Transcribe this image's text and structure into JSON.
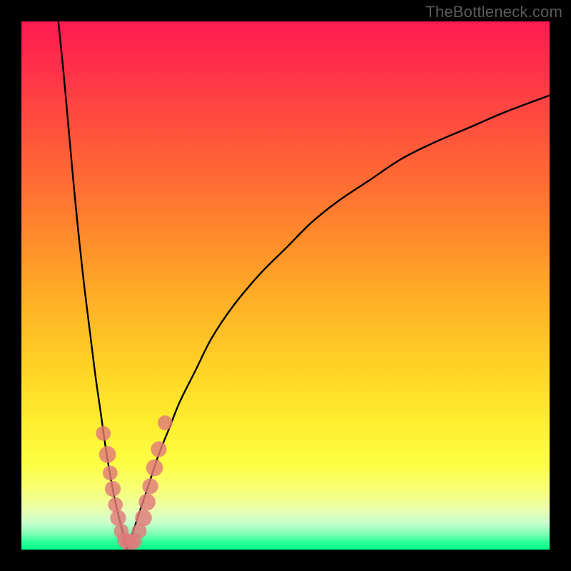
{
  "watermark": "TheBottleneck.com",
  "colors": {
    "frame": "#000000",
    "curve": "#000000",
    "marker_fill": "#e07a7a",
    "marker_stroke": "#c96464",
    "gradient_top": "#ff1a52",
    "gradient_bottom": "#00ff88"
  },
  "chart_data": {
    "type": "line",
    "title": "",
    "xlabel": "",
    "ylabel": "",
    "xlim": [
      0,
      100
    ],
    "ylim": [
      0,
      100
    ],
    "grid": false,
    "legend": false,
    "series": [
      {
        "name": "left-curve",
        "x": [
          7,
          8,
          9,
          10,
          11,
          12,
          13,
          14,
          15,
          16,
          17,
          18,
          19,
          20
        ],
        "y": [
          100,
          90,
          79,
          68,
          58,
          49,
          41,
          33,
          26,
          19,
          13,
          8,
          4,
          0
        ]
      },
      {
        "name": "right-curve",
        "x": [
          20,
          22,
          24,
          26,
          28,
          30,
          33,
          36,
          40,
          45,
          50,
          55,
          60,
          66,
          72,
          78,
          85,
          92,
          100
        ],
        "y": [
          0,
          6,
          12,
          18,
          23,
          28,
          34,
          40,
          46,
          52,
          57,
          62,
          66,
          70,
          74,
          77,
          80,
          83,
          86
        ]
      }
    ],
    "markers": {
      "name": "highlight-points",
      "type": "scatter",
      "points": [
        {
          "x": 15.5,
          "y": 22,
          "r": 1.4
        },
        {
          "x": 16.3,
          "y": 18,
          "r": 1.6
        },
        {
          "x": 16.8,
          "y": 14.5,
          "r": 1.4
        },
        {
          "x": 17.3,
          "y": 11.5,
          "r": 1.5
        },
        {
          "x": 17.8,
          "y": 8.5,
          "r": 1.4
        },
        {
          "x": 18.3,
          "y": 6,
          "r": 1.5
        },
        {
          "x": 18.9,
          "y": 3.5,
          "r": 1.4
        },
        {
          "x": 19.6,
          "y": 1.8,
          "r": 1.5
        },
        {
          "x": 20.4,
          "y": 1.2,
          "r": 1.6
        },
        {
          "x": 21.3,
          "y": 1.6,
          "r": 1.5
        },
        {
          "x": 22.3,
          "y": 3.5,
          "r": 1.4
        },
        {
          "x": 23.1,
          "y": 6,
          "r": 1.6
        },
        {
          "x": 23.8,
          "y": 9,
          "r": 1.6
        },
        {
          "x": 24.4,
          "y": 12,
          "r": 1.5
        },
        {
          "x": 25.2,
          "y": 15.5,
          "r": 1.6
        },
        {
          "x": 26.0,
          "y": 19,
          "r": 1.5
        },
        {
          "x": 27.2,
          "y": 24,
          "r": 1.4
        }
      ]
    }
  }
}
